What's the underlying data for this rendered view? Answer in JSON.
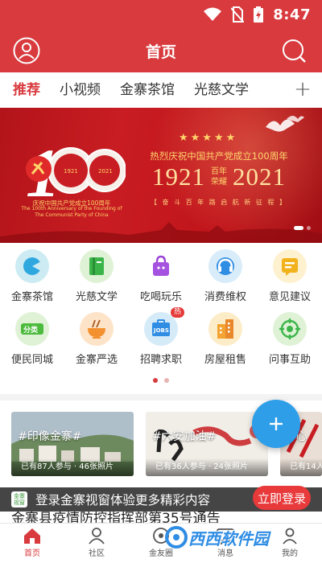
{
  "status_bar": {
    "time": "8:47"
  },
  "header": {
    "title": "首页"
  },
  "tabs": [
    {
      "label": "推荐",
      "active": true
    },
    {
      "label": "小视频",
      "active": false
    },
    {
      "label": "金寨茶馆",
      "active": false
    },
    {
      "label": "光慈文学",
      "active": false
    }
  ],
  "tabs_more": "+",
  "banner": {
    "headline": "热烈庆祝中国共产党成立100周年",
    "year_start": "1921",
    "year_end": "2021",
    "mid_top": "百年",
    "mid_bottom": "荣耀",
    "slogan": "【 奋 斗 百 年 路   启 航 新 征 程 】",
    "stars": "★★★★★",
    "logo_cn": "庆祝中国共产党成立100周年",
    "logo_en": "The 100th Anniversary of the Founding of The Communist Party of China",
    "slide_current": 1,
    "slide_total": 2
  },
  "shortcuts": [
    {
      "label": "金寨茶馆",
      "icon": "teahouse-icon",
      "bg": "#cdebf3"
    },
    {
      "label": "光慈文学",
      "icon": "book-icon",
      "bg": "#dff2d6"
    },
    {
      "label": "吃喝玩乐",
      "icon": "shopping-bag-icon",
      "bg": "#ffffff"
    },
    {
      "label": "消费维权",
      "icon": "headset-icon",
      "bg": "#d8ecfa"
    },
    {
      "label": "意见建议",
      "icon": "feedback-icon",
      "bg": "#fdf1cf"
    },
    {
      "label": "便民同城",
      "icon": "category-icon",
      "bg": "#dff2d6"
    },
    {
      "label": "金寨严选",
      "icon": "noodle-bowl-icon",
      "bg": "#fde3c8"
    },
    {
      "label": "招聘求职",
      "icon": "jobs-icon",
      "bg": "#d6ebf8",
      "badge": "热"
    },
    {
      "label": "房屋租售",
      "icon": "building-icon",
      "bg": "#fdecc8"
    },
    {
      "label": "问事互助",
      "icon": "target-icon",
      "bg": "#dff2d6"
    }
  ],
  "topics": [
    {
      "title": "#印像金寨#",
      "meta": "已有87人参与 · 46张照片"
    },
    {
      "title": "#六安加油#",
      "meta": "已有36人参与 · 24张照片"
    },
    {
      "title": "#心",
      "meta": "已有14人"
    }
  ],
  "login_bar": {
    "logo_text": "金寨视窗",
    "text": "登录金寨视窗体验更多精彩内容",
    "button": "立即登录"
  },
  "notice": "金寨县疫情防控指挥部第35号通告",
  "bottom_nav": [
    {
      "label": "首页",
      "icon": "home-icon",
      "active": true
    },
    {
      "label": "社区",
      "icon": "community-icon",
      "active": false
    },
    {
      "label": "金友圈",
      "icon": "circle-icon",
      "active": false
    },
    {
      "label": "消息",
      "icon": "message-icon",
      "active": false
    },
    {
      "label": "我的",
      "icon": "profile-icon",
      "active": false
    }
  ],
  "watermark": "西西软件园",
  "colors": {
    "brand_red": "#d83a3e",
    "fab_blue": "#2e9ee8"
  }
}
